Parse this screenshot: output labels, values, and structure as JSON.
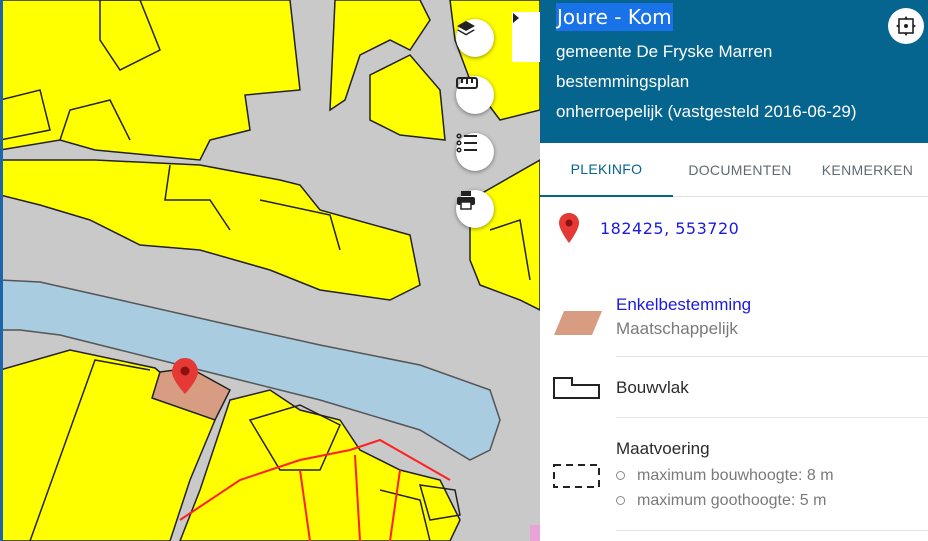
{
  "plan": {
    "title": "Joure - Kom",
    "municipality": "gemeente De Fryske Marren",
    "type": "bestemmingsplan",
    "status": "onherroepelijk (vastgesteld 2016-06-29)"
  },
  "tabs": [
    {
      "label": "PLEKINFO",
      "active": true
    },
    {
      "label": "DOCUMENTEN",
      "active": false
    },
    {
      "label": "KENMERKEN",
      "active": false
    }
  ],
  "location": {
    "coords": "182425, 553720"
  },
  "enkelbestemming": {
    "title": "Enkelbestemming",
    "value": "Maatschappelijk",
    "color": "#d89c82"
  },
  "bouwvlak": {
    "label": "Bouwvlak"
  },
  "maatvoering": {
    "title": "Maatvoering",
    "items": [
      "maximum bouwhoogte: 8 m",
      "maximum goothoogte: 5 m"
    ]
  },
  "map_controls": [
    "layers-icon",
    "ruler-icon",
    "legend-list-icon",
    "print-icon"
  ],
  "colors": {
    "header": "#05658f",
    "title_highlight": "#1a72e8",
    "link": "#1a1ae0",
    "plot_yellow": "#ffff00",
    "road_grey": "#c9c9c9",
    "water": "#a9cce0",
    "marker_red": "#e53935"
  }
}
